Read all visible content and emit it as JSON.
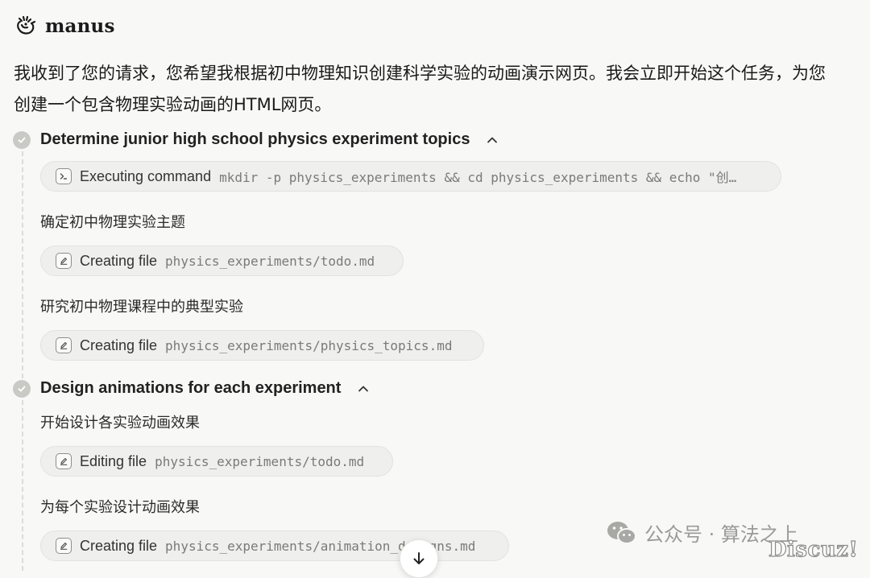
{
  "app": {
    "brand_name": "manus"
  },
  "message": {
    "intro": "我收到了您的请求，您希望我根据初中物理知识创建科学实验的动画演示网页。我会立即开始这个任务，为您创建一个包含物理实验动画的HTML网页。"
  },
  "steps": [
    {
      "title": "Determine junior high school physics experiment topics",
      "expanded": true,
      "items": [
        {
          "type": "action",
          "icon": "terminal-icon",
          "action": "Executing command",
          "arg": "mkdir -p physics_experiments && cd physics_experiments && echo \"创…"
        },
        {
          "type": "note",
          "text": "确定初中物理实验主题"
        },
        {
          "type": "action",
          "icon": "edit-icon",
          "action": "Creating file",
          "arg": "physics_experiments/todo.md"
        },
        {
          "type": "note",
          "text": "研究初中物理课程中的典型实验"
        },
        {
          "type": "action",
          "icon": "edit-icon",
          "action": "Creating file",
          "arg": "physics_experiments/physics_topics.md"
        }
      ]
    },
    {
      "title": "Design animations for each experiment",
      "expanded": true,
      "items": [
        {
          "type": "note",
          "text": "开始设计各实验动画效果"
        },
        {
          "type": "action",
          "icon": "edit-icon",
          "action": "Editing file",
          "arg": "physics_experiments/todo.md"
        },
        {
          "type": "note",
          "text": "为每个实验设计动画效果"
        },
        {
          "type": "action",
          "icon": "edit-icon",
          "action": "Creating file",
          "arg": "physics_experiments/animation_designs.md"
        }
      ]
    }
  ],
  "watermark": {
    "text": "公众号 · 算法之上",
    "badge": "Discuz!"
  },
  "colors": {
    "background": "#f8f8f7",
    "pill_background": "#efefed",
    "check_gray": "#c9c9c6"
  }
}
